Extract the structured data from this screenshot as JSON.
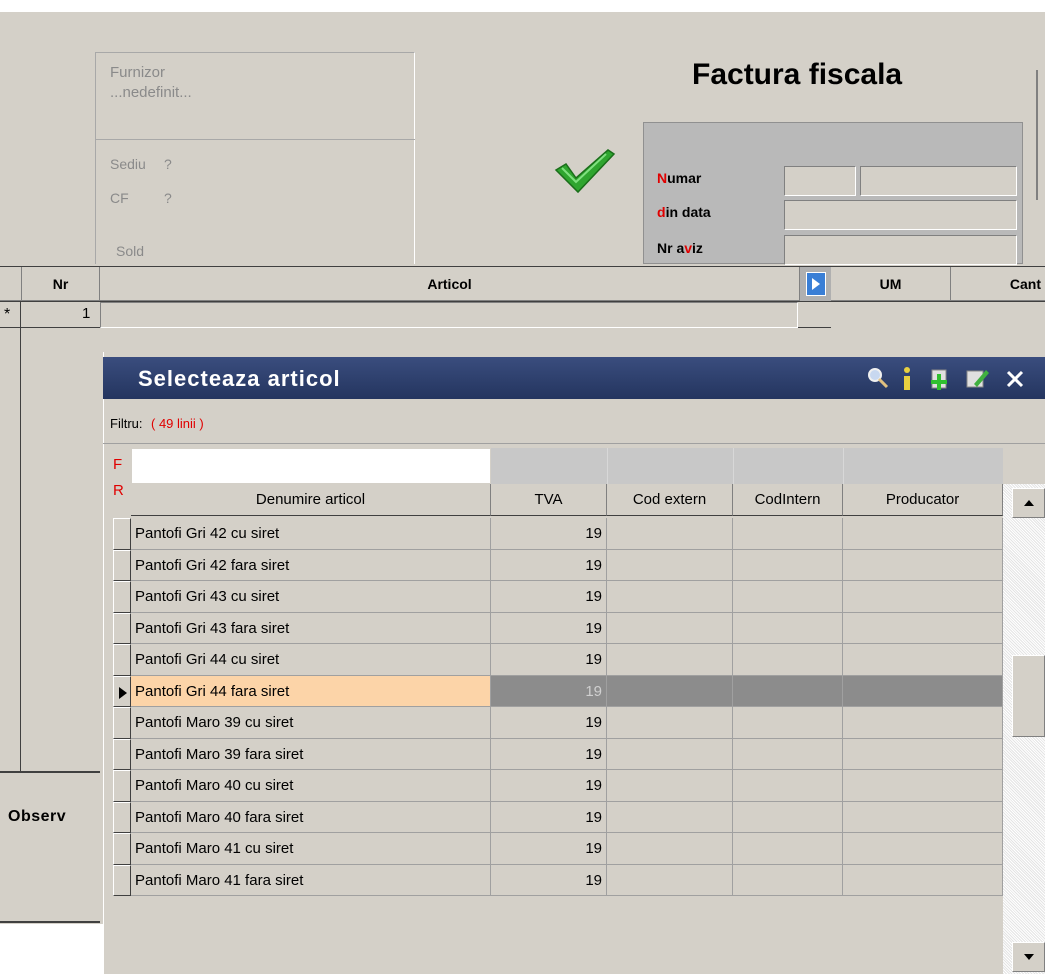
{
  "supplier": {
    "label": "Furnizor",
    "value": "...nedefinit...",
    "sediu_label": "Sediu",
    "sediu_value": "?",
    "cf_label": "CF",
    "cf_value": "?",
    "sold_label": "Sold"
  },
  "invoice": {
    "title": "Factura fiscala",
    "numar_hot": "N",
    "numar_rest": "umar",
    "data_hot": "d",
    "data_rest": "in data",
    "aviz_pre": "Nr a",
    "aviz_hot": "v",
    "aviz_post": "iz"
  },
  "grid": {
    "col_nr": "Nr",
    "col_articol": "Articol",
    "col_um": "UM",
    "col_cant": "Cant",
    "row_marker": "*",
    "row_nr": "1",
    "observ_label": "Observ"
  },
  "dialog": {
    "title": "Selecteaza articol",
    "filter_label": "Filtru:",
    "filter_count": "( 49 linii )",
    "f_marker": "F",
    "r_marker": "R",
    "columns": [
      "Denumire articol",
      "TVA",
      "Cod extern",
      "CodIntern",
      "Producator"
    ],
    "rows": [
      {
        "name": "Pantofi Gri 42 cu siret",
        "tva": "19",
        "selected": false
      },
      {
        "name": "Pantofi Gri 42 fara siret",
        "tva": "19",
        "selected": false
      },
      {
        "name": "Pantofi Gri 43 cu siret",
        "tva": "19",
        "selected": false
      },
      {
        "name": "Pantofi Gri 43 fara siret",
        "tva": "19",
        "selected": false
      },
      {
        "name": "Pantofi Gri 44 cu siret",
        "tva": "19",
        "selected": false
      },
      {
        "name": "Pantofi Gri 44 fara siret",
        "tva": "19",
        "selected": true
      },
      {
        "name": "Pantofi Maro 39 cu siret",
        "tva": "19",
        "selected": false
      },
      {
        "name": "Pantofi Maro 39 fara siret",
        "tva": "19",
        "selected": false
      },
      {
        "name": "Pantofi Maro 40 cu siret",
        "tva": "19",
        "selected": false
      },
      {
        "name": "Pantofi Maro 40 fara siret",
        "tva": "19",
        "selected": false
      },
      {
        "name": "Pantofi Maro 41 cu siret",
        "tva": "19",
        "selected": false
      },
      {
        "name": "Pantofi Maro 41 fara siret",
        "tva": "19",
        "selected": false
      }
    ],
    "toolbar_icons": [
      "search-icon",
      "info-icon",
      "add-icon",
      "edit-icon",
      "close-icon"
    ],
    "colors": {
      "titlebar": "#2c3e6b",
      "selected_row": "#fcd4a8",
      "selected_cells": "#8c8c8c",
      "bg": "#d4d0c8"
    }
  }
}
